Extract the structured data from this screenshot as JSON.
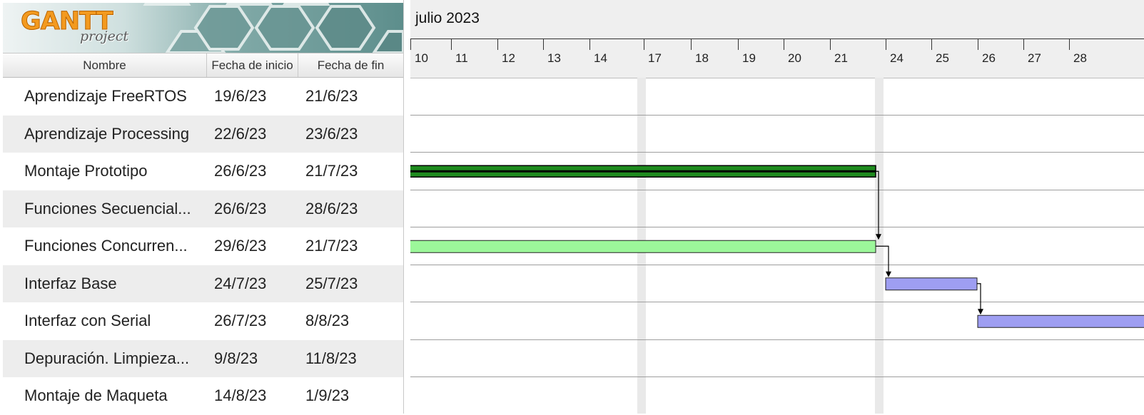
{
  "app": {
    "logo_main": "GANTT",
    "logo_sub": "project"
  },
  "table": {
    "columns": [
      "Nombre",
      "Fecha de inicio",
      "Fecha de fin"
    ],
    "rows": [
      {
        "name": "Aprendizaje FreeRTOS",
        "start": "19/6/23",
        "end": "21/6/23"
      },
      {
        "name": "Aprendizaje Processing",
        "start": "22/6/23",
        "end": "23/6/23"
      },
      {
        "name": "Montaje Prototipo",
        "start": "26/6/23",
        "end": "21/7/23"
      },
      {
        "name": "Funciones Secuencial...",
        "start": "26/6/23",
        "end": "28/6/23"
      },
      {
        "name": "Funciones Concurren...",
        "start": "29/6/23",
        "end": "21/7/23"
      },
      {
        "name": "Interfaz Base",
        "start": "24/7/23",
        "end": "25/7/23"
      },
      {
        "name": "Interfaz con Serial",
        "start": "26/7/23",
        "end": "8/8/23"
      },
      {
        "name": "Depuración. Limpieza...",
        "start": "9/8/23",
        "end": "11/8/23"
      },
      {
        "name": "Montaje de Maqueta",
        "start": "14/8/23",
        "end": "1/9/23"
      }
    ]
  },
  "timeline": {
    "month": "julio 2023",
    "days": [
      "10",
      "11",
      "12",
      "13",
      "14",
      "17",
      "18",
      "19",
      "20",
      "21",
      "24",
      "25",
      "26",
      "27",
      "28"
    ]
  },
  "chart_data": {
    "type": "gantt",
    "tasks": [
      {
        "row": 2,
        "start": "26/6/23",
        "end": "21/7/23",
        "style": "summary",
        "color": "#1e8a1e"
      },
      {
        "row": 4,
        "start": "29/6/23",
        "end": "21/7/23",
        "style": "task",
        "color": "#9cf79a"
      },
      {
        "row": 5,
        "start": "24/7/23",
        "end": "25/7/23",
        "style": "task",
        "color": "#9e9ef2"
      },
      {
        "row": 6,
        "start": "26/7/23",
        "end": "8/8/23",
        "style": "task",
        "color": "#9e9ef2"
      }
    ],
    "dependencies": [
      {
        "from": 2,
        "to": 4
      },
      {
        "from": 4,
        "to": 5
      },
      {
        "from": 5,
        "to": 6
      }
    ],
    "weekend_bands": [
      "15-16",
      "22-23"
    ]
  }
}
